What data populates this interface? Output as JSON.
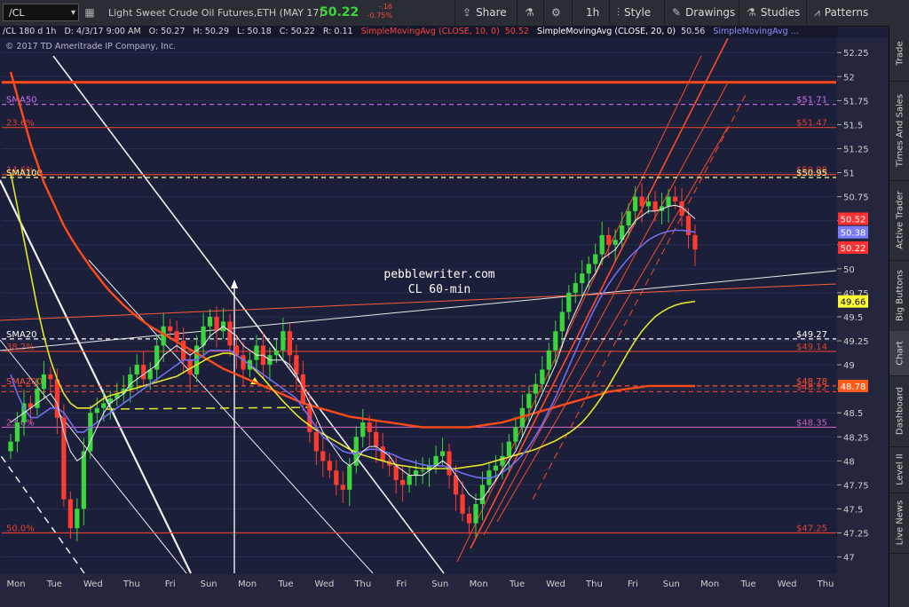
{
  "toolbar": {
    "symbol": "/CL",
    "description": "Light Sweet Crude Oil Futures,ETH (MAY 17)",
    "last": "50.22",
    "change": "-.16",
    "change_pct": "-0.75%",
    "buttons": {
      "share": "Share",
      "timeframe": "1h",
      "style": "Style",
      "drawings": "Drawings",
      "studies": "Studies",
      "patterns": "Patterns"
    }
  },
  "infobar": {
    "symbol_period": "/CL 180 d 1h",
    "date": "D: 4/3/17 9:00 AM",
    "open": "O: 50.27",
    "high": "H: 50.29",
    "low": "L: 50.18",
    "close": "C: 50.22",
    "range": "R: 0.11",
    "sma10": "SimpleMovingAvg (CLOSE, 10, 0)",
    "sma10_val": "50.52",
    "sma20": "SimpleMovingAvg (CLOSE, 20, 0)",
    "sma20_val": "50.56",
    "sma_more": "SimpleMovingAvg ..."
  },
  "copyright": "© 2017 TD Ameritrade IP Company, Inc.",
  "overlay_text": [
    "pebblewriter.com",
    "CL 60-min"
  ],
  "sidebar_tabs": [
    "Trade",
    "Times And Sales",
    "Active Trader",
    "Big Buttons",
    "Chart",
    "Dashboard",
    "Level II",
    "Live News"
  ],
  "colors": {
    "background": "#1b1f3a",
    "candle_up": "#3bd63b",
    "candle_down": "#ff3b30",
    "sma_slow": "#ff4a1a",
    "sma_mid": "#e5e52a",
    "sma_blue": "#6e6ef0",
    "fib": "#ff5a4a",
    "sma_label": "#e07be0"
  },
  "chart_data": {
    "type": "candlestick",
    "ylim": [
      46.83,
      52.4
    ],
    "y_ticks": [
      47,
      47.25,
      47.5,
      47.75,
      48,
      48.25,
      48.5,
      48.75,
      49,
      49.25,
      49.5,
      49.75,
      50,
      50.25,
      50.5,
      50.75,
      51,
      51.25,
      51.5,
      51.75,
      52,
      52.25
    ],
    "x_labels": [
      "Mon",
      "Tue",
      "Wed",
      "Thu",
      "Fri",
      "Sun",
      "Mon",
      "Tue",
      "Wed",
      "Thu",
      "Fri",
      "Sun",
      "Mon",
      "Tue",
      "Wed",
      "Thu",
      "Fri",
      "Sun",
      "Mon",
      "Tue",
      "Wed",
      "Thu"
    ],
    "price_tags": [
      {
        "value": 50.52,
        "label": "50.52",
        "color": "#ff3030"
      },
      {
        "value": 50.38,
        "label": "50.38",
        "color": "#7b7bff"
      },
      {
        "value": 50.22,
        "label": "50.22",
        "color": "#ff3030"
      },
      {
        "value": 49.66,
        "label": "49.66",
        "color": "#ffff33"
      },
      {
        "value": 48.78,
        "label": "48.78",
        "color": "#ff5a1a"
      }
    ],
    "levels": [
      {
        "name": "SMA50",
        "value": 51.71,
        "label": "$51.71",
        "color": "#d070f0",
        "style": "dash"
      },
      {
        "name": "23.6%",
        "value": 51.47,
        "label": "$51.47",
        "color": "#e04030",
        "style": "solid"
      },
      {
        "name": "14.6%",
        "value": 50.98,
        "label": "$50.98",
        "color": "#e04030",
        "style": "solid"
      },
      {
        "name": "SMA100",
        "value": 50.95,
        "label": "$50.95",
        "color": "#ffff88",
        "style": "dash"
      },
      {
        "name": "SMA20",
        "value": 49.27,
        "label": "$49.27",
        "color": "#ffffff",
        "style": "dash"
      },
      {
        "name": "38.2%",
        "value": 49.14,
        "label": "$49.14",
        "color": "#e04030",
        "style": "solid"
      },
      {
        "name": "SMA200",
        "value": 48.78,
        "label": "$48.78",
        "color": "#ff5030",
        "style": "dash"
      },
      {
        "name": "",
        "value": 48.72,
        "label": "$48.72",
        "color": "#e04030",
        "style": "dash"
      },
      {
        "name": "23.6%",
        "value": 48.35,
        "label": "$48.35",
        "color": "#c060c0",
        "style": "solid"
      },
      {
        "name": "50.0%",
        "value": 47.25,
        "label": "$47.25",
        "color": "#e04030",
        "style": "solid"
      }
    ],
    "top_level": 51.94,
    "candles_close": [
      48.2,
      48.4,
      48.6,
      48.55,
      48.75,
      48.9,
      48.85,
      48.45,
      47.6,
      47.3,
      47.5,
      48.1,
      48.5,
      48.55,
      48.6,
      48.65,
      48.7,
      48.75,
      48.9,
      49.0,
      48.85,
      48.95,
      49.2,
      49.4,
      49.35,
      49.25,
      49.05,
      48.9,
      49.2,
      49.4,
      49.5,
      49.35,
      49.45,
      49.2,
      49.1,
      48.95,
      49.05,
      49.2,
      49.0,
      49.1,
      49.15,
      49.35,
      49.1,
      48.9,
      48.6,
      48.3,
      48.1,
      48.0,
      47.9,
      47.75,
      47.7,
      47.95,
      48.25,
      48.4,
      48.3,
      48.15,
      48.0,
      47.95,
      47.8,
      47.75,
      47.85,
      47.9,
      47.9,
      47.95,
      48.05,
      48.1,
      47.85,
      47.65,
      47.45,
      47.35,
      47.55,
      47.75,
      47.9,
      47.95,
      48.05,
      48.2,
      48.35,
      48.55,
      48.7,
      48.8,
      48.95,
      49.15,
      49.35,
      49.55,
      49.75,
      49.85,
      49.95,
      50.05,
      50.15,
      50.35,
      50.25,
      50.3,
      50.45,
      50.6,
      50.75,
      50.65,
      50.7,
      50.6,
      50.65,
      50.75,
      50.7,
      50.55,
      50.35,
      50.2
    ],
    "sma_fast_white": [
      48.4,
      48.45,
      48.5,
      48.55,
      48.6,
      48.65,
      48.7,
      48.6,
      48.3,
      48.1,
      48.0,
      48.05,
      48.2,
      48.35,
      48.5,
      48.6,
      48.65,
      48.7,
      48.8,
      48.85,
      48.9,
      48.95,
      49.0,
      49.1,
      49.15,
      49.2,
      49.15,
      49.1,
      49.15,
      49.2,
      49.3,
      49.35,
      49.4,
      49.35,
      49.3,
      49.2,
      49.15,
      49.1,
      49.1,
      49.05,
      49.05,
      49.05,
      49.0,
      48.9,
      48.75,
      48.6,
      48.45,
      48.3,
      48.2,
      48.1,
      48.0,
      47.95,
      48.0,
      48.1,
      48.15,
      48.15,
      48.1,
      48.05,
      47.95,
      47.9,
      47.85,
      47.85,
      47.85,
      47.9,
      47.95,
      48.0,
      47.95,
      47.85,
      47.75,
      47.65,
      47.6,
      47.6,
      47.7,
      47.8,
      47.9,
      48.0,
      48.1,
      48.25,
      48.4,
      48.55,
      48.7,
      48.85,
      49.0,
      49.2,
      49.4,
      49.55,
      49.7,
      49.85,
      49.95,
      50.1,
      50.15,
      50.2,
      50.3,
      50.4,
      50.5,
      50.55,
      50.6,
      50.6,
      50.62,
      50.65,
      50.66,
      50.64,
      50.58,
      50.52
    ],
    "sma_blue": [
      48.9,
      48.7,
      48.55,
      48.45,
      48.45,
      48.5,
      48.55,
      48.55,
      48.5,
      48.4,
      48.3,
      48.3,
      48.35,
      48.4,
      48.45,
      48.5,
      48.55,
      48.6,
      48.65,
      48.7,
      48.75,
      48.8,
      48.85,
      48.9,
      48.95,
      49.0,
      49.05,
      49.05,
      49.05,
      49.1,
      49.15,
      49.15,
      49.15,
      49.15,
      49.1,
      49.05,
      49.0,
      48.95,
      48.9,
      48.85,
      48.8,
      48.75,
      48.7,
      48.65,
      48.55,
      48.45,
      48.35,
      48.25,
      48.2,
      48.15,
      48.1,
      48.08,
      48.08,
      48.1,
      48.12,
      48.12,
      48.1,
      48.08,
      48.05,
      48.02,
      48.0,
      47.98,
      47.96,
      47.95,
      47.95,
      47.95,
      47.93,
      47.9,
      47.87,
      47.85,
      47.83,
      47.82,
      47.82,
      47.84,
      47.88,
      47.93,
      47.99,
      48.06,
      48.15,
      48.26,
      48.38,
      48.52,
      48.66,
      48.82,
      48.98,
      49.14,
      49.3,
      49.46,
      49.6,
      49.73,
      49.84,
      49.94,
      50.03,
      50.11,
      50.18,
      50.24,
      50.3,
      50.34,
      50.37,
      50.39,
      50.4,
      50.4,
      50.39,
      50.38
    ],
    "sma_mid_yellow": [
      51.0,
      50.65,
      50.3,
      49.95,
      49.6,
      49.3,
      49.05,
      48.85,
      48.7,
      48.6,
      48.55,
      48.55,
      48.55,
      48.6,
      48.65,
      48.68,
      48.7,
      48.72,
      48.74,
      48.76,
      48.78,
      48.8,
      48.82,
      48.84,
      48.86,
      48.88,
      48.92,
      48.96,
      49.0,
      49.04,
      49.08,
      49.1,
      49.12,
      49.12,
      49.1,
      49.05,
      49.0,
      48.93,
      48.86,
      48.78,
      48.7,
      48.62,
      48.55,
      48.48,
      48.42,
      48.37,
      48.32,
      48.28,
      48.24,
      48.2,
      48.16,
      48.12,
      48.09,
      48.06,
      48.04,
      48.02,
      48.0,
      47.98,
      47.96,
      47.95,
      47.94,
      47.93,
      47.92,
      47.92,
      47.92,
      47.92,
      47.92,
      47.92,
      47.93,
      47.94,
      47.95,
      47.96,
      47.98,
      48.0,
      48.02,
      48.04,
      48.06,
      48.08,
      48.1,
      48.12,
      48.15,
      48.18,
      48.21,
      48.25,
      48.29,
      48.34,
      48.4,
      48.48,
      48.57,
      48.67,
      48.78,
      48.9,
      49.02,
      49.14,
      49.25,
      49.35,
      49.43,
      49.5,
      49.55,
      49.59,
      49.62,
      49.64,
      49.65,
      49.66
    ],
    "sma_slow_red": [
      52.05,
      51.8,
      51.55,
      51.3,
      51.1,
      50.9,
      50.75,
      50.6,
      50.45,
      50.33,
      50.22,
      50.12,
      50.02,
      49.93,
      49.84,
      49.76,
      49.69,
      49.62,
      49.56,
      49.5,
      49.45,
      49.4,
      49.36,
      49.32,
      49.28,
      49.24,
      49.2,
      49.16,
      49.12,
      49.08,
      49.04,
      49.0,
      48.96,
      48.93,
      48.9,
      48.87,
      48.84,
      48.81,
      48.78,
      48.75,
      48.72,
      48.69,
      48.66,
      48.63,
      48.6,
      48.58,
      48.56,
      48.54,
      48.52,
      48.5,
      48.48,
      48.46,
      48.45,
      48.44,
      48.43,
      48.42,
      48.41,
      48.4,
      48.39,
      48.38,
      48.37,
      48.36,
      48.35,
      48.35,
      48.35,
      48.35,
      48.35,
      48.35,
      48.35,
      48.35,
      48.36,
      48.37,
      48.38,
      48.39,
      48.4,
      48.42,
      48.44,
      48.46,
      48.48,
      48.5,
      48.52,
      48.54,
      48.56,
      48.58,
      48.6,
      48.62,
      48.64,
      48.66,
      48.68,
      48.7,
      48.72,
      48.73,
      48.74,
      48.75,
      48.76,
      48.77,
      48.78,
      48.78,
      48.78,
      48.78,
      48.78,
      48.78,
      48.78,
      48.78
    ]
  }
}
